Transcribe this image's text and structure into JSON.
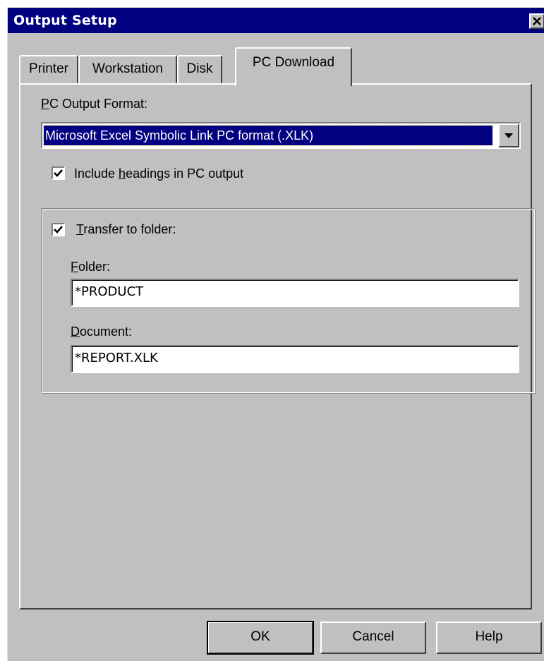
{
  "window": {
    "title": "Output Setup",
    "title_bar_color": "#000080",
    "close_icon": "close-icon"
  },
  "tabs": [
    {
      "label": "Printer",
      "active": false
    },
    {
      "label": "Workstation",
      "active": false
    },
    {
      "label": "Disk",
      "active": false
    },
    {
      "label": "PC Download",
      "active": true
    }
  ],
  "pc_download": {
    "format_label_accel": "P",
    "format_label_rest": "C Output Format:",
    "format_value": "Microsoft Excel Symbolic Link PC format (.XLK)",
    "include_headings": {
      "checked": true,
      "label_pre": "Include ",
      "label_accel": "h",
      "label_post": "eadings in PC output"
    },
    "transfer": {
      "checked": true,
      "label_accel": "T",
      "label_rest": "ransfer to folder:"
    },
    "folder": {
      "label_accel": "F",
      "label_rest": "older:",
      "value": "*PRODUCT"
    },
    "document": {
      "label_accel": "D",
      "label_rest": "ocument:",
      "value": "*REPORT.XLK"
    }
  },
  "buttons": {
    "ok": "OK",
    "cancel": "Cancel",
    "help": "Help"
  }
}
